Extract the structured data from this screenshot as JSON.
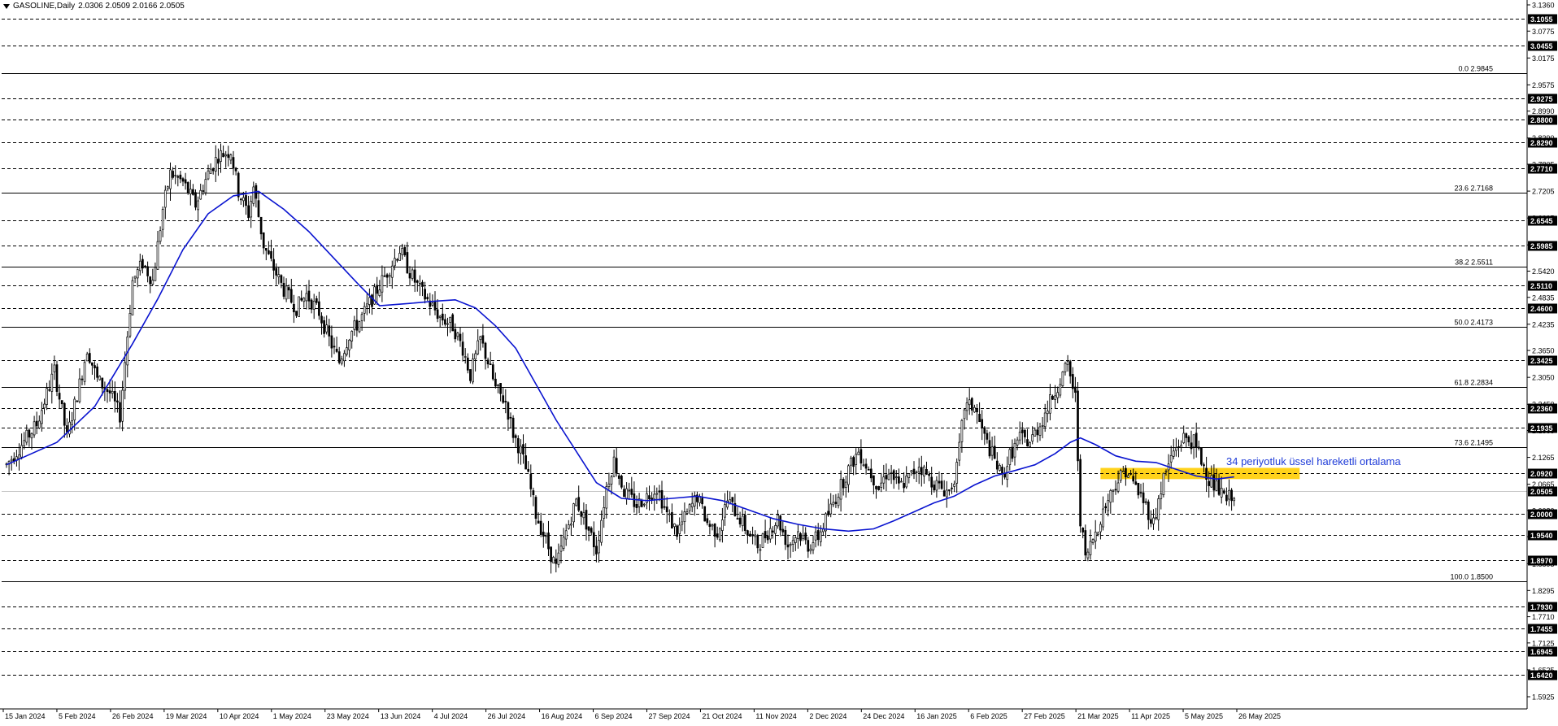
{
  "header": {
    "symbol_line": "GASOLINE,Daily",
    "ohlc": "2.0306 2.0509 2.0166 2.0505"
  },
  "annotation": {
    "text": "34 periyotluk üssel hareketli ortalama",
    "color": "#1e3bd8"
  },
  "colors": {
    "candles": "#000000",
    "ema": "#0a14d0",
    "highlight": "#ffd21a",
    "grid": "#000000",
    "background": "#ffffff"
  },
  "chart_data": {
    "type": "candlestick",
    "ylim": [
      1.5925,
      3.136
    ],
    "axis_ticks": [
      "3.1360",
      "3.0775",
      "3.0175",
      "2.9575",
      "2.8990",
      "2.8390",
      "2.7805",
      "2.7205",
      "2.6605",
      "2.6005",
      "2.5420",
      "2.4835",
      "2.4235",
      "2.3650",
      "2.3050",
      "2.2450",
      "2.1865",
      "2.1265",
      "2.0665",
      "2.0080",
      "1.9495",
      "1.8895",
      "1.8295",
      "1.7710",
      "1.7125",
      "1.6525",
      "1.5925"
    ],
    "horizontal_levels": [
      {
        "label": "3.1055",
        "value": 3.1055
      },
      {
        "label": "3.0455",
        "value": 3.0455
      },
      {
        "label": "2.9275",
        "value": 2.9275
      },
      {
        "label": "2.8800",
        "value": 2.88
      },
      {
        "label": "2.8290",
        "value": 2.829
      },
      {
        "label": "2.7710",
        "value": 2.771
      },
      {
        "label": "2.6545",
        "value": 2.6545
      },
      {
        "label": "2.5985",
        "value": 2.5985
      },
      {
        "label": "2.5110",
        "value": 2.511
      },
      {
        "label": "2.4600",
        "value": 2.46
      },
      {
        "label": "2.3425",
        "value": 2.3425
      },
      {
        "label": "2.2360",
        "value": 2.236
      },
      {
        "label": "2.1935",
        "value": 2.1935
      },
      {
        "label": "2.0920",
        "value": 2.092
      },
      {
        "label": "2.0000",
        "value": 2.0
      },
      {
        "label": "1.9540",
        "value": 1.954
      },
      {
        "label": "1.8970",
        "value": 1.897
      },
      {
        "label": "1.7930",
        "value": 1.793
      },
      {
        "label": "1.7455",
        "value": 1.7455
      },
      {
        "label": "1.6945",
        "value": 1.6945
      },
      {
        "label": "1.6420",
        "value": 1.642
      }
    ],
    "current_price": {
      "label": "2.0505",
      "value": 2.0505
    },
    "fibonacci": [
      {
        "label": "0.0 2.9845",
        "value": 2.9845
      },
      {
        "label": "23.6 2.7168",
        "value": 2.7168
      },
      {
        "label": "38.2 2.5511",
        "value": 2.5511
      },
      {
        "label": "50.0 2.4173",
        "value": 2.4173
      },
      {
        "label": "61.8 2.2834",
        "value": 2.2834
      },
      {
        "label": "73.6 2.1495",
        "value": 2.1495
      },
      {
        "label": "100.0 1.8500",
        "value": 1.85
      }
    ],
    "x_labels": [
      "15 Jan 2024",
      "5 Feb 2024",
      "26 Feb 2024",
      "19 Mar 2024",
      "10 Apr 2024",
      "1 May 2024",
      "23 May 2024",
      "13 Jun 2024",
      "4 Jul 2024",
      "26 Jul 2024",
      "16 Aug 2024",
      "6 Sep 2024",
      "27 Sep 2024",
      "21 Oct 2024",
      "11 Nov 2024",
      "2 Dec 2024",
      "24 Dec 2024",
      "16 Jan 2025",
      "6 Feb 2025",
      "27 Feb 2025",
      "21 Mar 2025",
      "11 Apr 2025",
      "5 May 2025",
      "26 May 2025"
    ],
    "price_path": [
      [
        0,
        2.11
      ],
      [
        12,
        2.2
      ],
      [
        19,
        2.32
      ],
      [
        24,
        2.17
      ],
      [
        26,
        2.22
      ],
      [
        29,
        2.29
      ],
      [
        32,
        2.37
      ],
      [
        36,
        2.3
      ],
      [
        41,
        2.27
      ],
      [
        45,
        2.22
      ],
      [
        50,
        2.52
      ],
      [
        54,
        2.56
      ],
      [
        58,
        2.52
      ],
      [
        62,
        2.68
      ],
      [
        65,
        2.76
      ],
      [
        70,
        2.74
      ],
      [
        75,
        2.69
      ],
      [
        80,
        2.76
      ],
      [
        84,
        2.8
      ],
      [
        89,
        2.81
      ],
      [
        92,
        2.72
      ],
      [
        96,
        2.67
      ],
      [
        98,
        2.73
      ],
      [
        102,
        2.6
      ],
      [
        105,
        2.56
      ],
      [
        110,
        2.5
      ],
      [
        115,
        2.46
      ],
      [
        119,
        2.49
      ],
      [
        124,
        2.45
      ],
      [
        128,
        2.39
      ],
      [
        132,
        2.34
      ],
      [
        136,
        2.4
      ],
      [
        140,
        2.43
      ],
      [
        144,
        2.47
      ],
      [
        148,
        2.51
      ],
      [
        152,
        2.55
      ],
      [
        156,
        2.59
      ],
      [
        160,
        2.54
      ],
      [
        164,
        2.5
      ],
      [
        168,
        2.47
      ],
      [
        172,
        2.44
      ],
      [
        177,
        2.42
      ],
      [
        181,
        2.37
      ],
      [
        184,
        2.31
      ],
      [
        188,
        2.39
      ],
      [
        191,
        2.34
      ],
      [
        194,
        2.28
      ],
      [
        198,
        2.25
      ],
      [
        201,
        2.18
      ],
      [
        204,
        2.14
      ],
      [
        207,
        2.08
      ],
      [
        210,
        2.0
      ],
      [
        214,
        1.94
      ],
      [
        218,
        1.88
      ],
      [
        222,
        1.96
      ],
      [
        226,
        2.03
      ],
      [
        230,
        1.98
      ],
      [
        234,
        1.92
      ],
      [
        238,
        2.06
      ],
      [
        241,
        2.12
      ],
      [
        245,
        2.05
      ],
      [
        250,
        2.02
      ],
      [
        254,
        2.04
      ],
      [
        258,
        2.06
      ],
      [
        262,
        2.0
      ],
      [
        266,
        1.96
      ],
      [
        270,
        2.0
      ],
      [
        274,
        2.04
      ],
      [
        278,
        1.98
      ],
      [
        282,
        1.96
      ],
      [
        286,
        2.03
      ],
      [
        290,
        2.0
      ],
      [
        294,
        1.96
      ],
      [
        298,
        1.93
      ],
      [
        302,
        1.96
      ],
      [
        306,
        1.99
      ],
      [
        310,
        1.93
      ],
      [
        314,
        1.96
      ],
      [
        318,
        1.93
      ],
      [
        322,
        1.95
      ],
      [
        326,
        2.0
      ],
      [
        330,
        2.05
      ],
      [
        334,
        2.1
      ],
      [
        338,
        2.14
      ],
      [
        342,
        2.1
      ],
      [
        346,
        2.06
      ],
      [
        350,
        2.1
      ],
      [
        354,
        2.06
      ],
      [
        358,
        2.08
      ],
      [
        362,
        2.11
      ],
      [
        366,
        2.08
      ],
      [
        370,
        2.06
      ],
      [
        374,
        2.05
      ],
      [
        377,
        2.1
      ],
      [
        380,
        2.24
      ],
      [
        384,
        2.24
      ],
      [
        388,
        2.17
      ],
      [
        392,
        2.12
      ],
      [
        395,
        2.08
      ],
      [
        398,
        2.13
      ],
      [
        402,
        2.17
      ],
      [
        406,
        2.16
      ],
      [
        410,
        2.2
      ],
      [
        414,
        2.25
      ],
      [
        418,
        2.3
      ],
      [
        421,
        2.33
      ],
      [
        424,
        2.26
      ],
      [
        426,
        1.99
      ],
      [
        428,
        1.9
      ],
      [
        432,
        1.96
      ],
      [
        436,
        2.02
      ],
      [
        440,
        2.07
      ],
      [
        444,
        2.1
      ],
      [
        448,
        2.06
      ],
      [
        451,
        2.03
      ],
      [
        455,
        1.98
      ],
      [
        459,
        2.08
      ],
      [
        463,
        2.14
      ],
      [
        467,
        2.17
      ],
      [
        471,
        2.16
      ],
      [
        474,
        2.12
      ],
      [
        477,
        2.08
      ],
      [
        481,
        2.05
      ],
      [
        484,
        2.03
      ],
      [
        487,
        2.05
      ]
    ],
    "ema": [
      [
        0,
        2.11
      ],
      [
        20,
        2.16
      ],
      [
        35,
        2.24
      ],
      [
        50,
        2.38
      ],
      [
        60,
        2.48
      ],
      [
        70,
        2.59
      ],
      [
        80,
        2.67
      ],
      [
        90,
        2.71
      ],
      [
        100,
        2.72
      ],
      [
        110,
        2.68
      ],
      [
        120,
        2.63
      ],
      [
        130,
        2.57
      ],
      [
        140,
        2.51
      ],
      [
        148,
        2.465
      ],
      [
        160,
        2.47
      ],
      [
        170,
        2.475
      ],
      [
        178,
        2.478
      ],
      [
        186,
        2.46
      ],
      [
        194,
        2.42
      ],
      [
        202,
        2.37
      ],
      [
        210,
        2.29
      ],
      [
        218,
        2.21
      ],
      [
        226,
        2.14
      ],
      [
        234,
        2.07
      ],
      [
        244,
        2.035
      ],
      [
        254,
        2.03
      ],
      [
        264,
        2.035
      ],
      [
        274,
        2.04
      ],
      [
        284,
        2.03
      ],
      [
        294,
        2.01
      ],
      [
        304,
        1.99
      ],
      [
        314,
        1.977
      ],
      [
        324,
        1.967
      ],
      [
        334,
        1.962
      ],
      [
        344,
        1.967
      ],
      [
        352,
        1.985
      ],
      [
        360,
        2.005
      ],
      [
        368,
        2.025
      ],
      [
        376,
        2.04
      ],
      [
        384,
        2.065
      ],
      [
        392,
        2.085
      ],
      [
        400,
        2.097
      ],
      [
        408,
        2.11
      ],
      [
        416,
        2.135
      ],
      [
        422,
        2.16
      ],
      [
        426,
        2.17
      ],
      [
        432,
        2.155
      ],
      [
        440,
        2.13
      ],
      [
        448,
        2.118
      ],
      [
        456,
        2.115
      ],
      [
        464,
        2.1
      ],
      [
        472,
        2.085
      ],
      [
        480,
        2.078
      ],
      [
        487,
        2.083
      ]
    ],
    "highlight_zone": {
      "from_bar": 434,
      "to_bar": 513,
      "low": 2.078,
      "high": 2.103
    }
  }
}
